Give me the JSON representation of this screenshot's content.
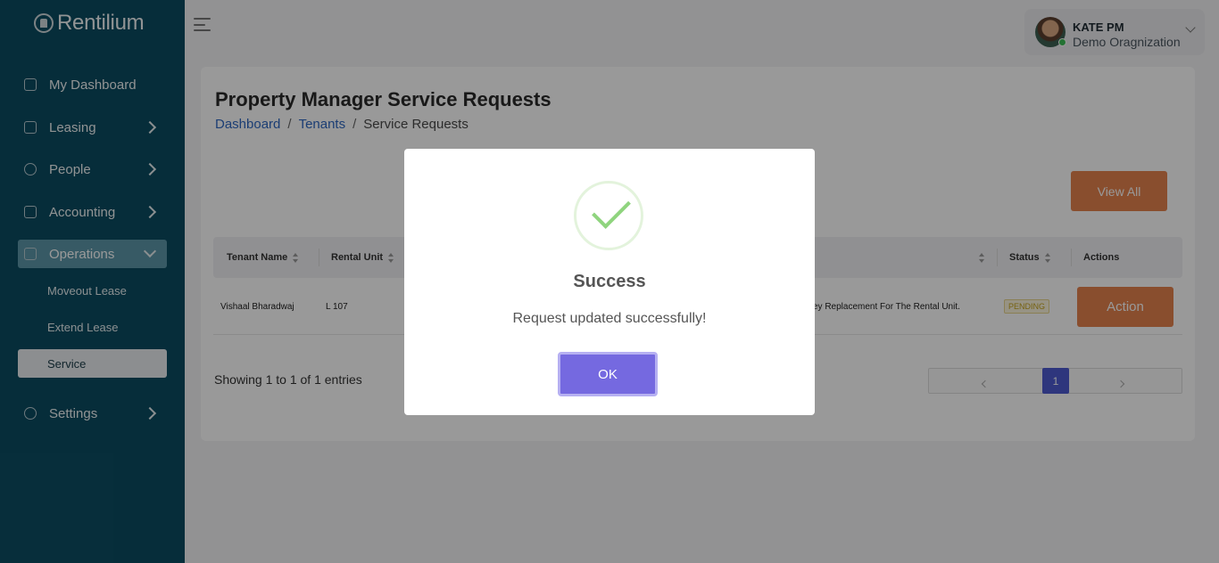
{
  "app": {
    "name": "Rentilium"
  },
  "sidebar": {
    "items": [
      {
        "label": "My Dashboard"
      },
      {
        "label": "Leasing"
      },
      {
        "label": "People"
      },
      {
        "label": "Accounting"
      },
      {
        "label": "Operations"
      },
      {
        "label": "Settings"
      }
    ],
    "subitems": [
      {
        "label": "Moveout Lease"
      },
      {
        "label": "Extend Lease"
      },
      {
        "label": "Service"
      }
    ]
  },
  "user": {
    "name": "KATE PM",
    "org": "Demo Oragnization"
  },
  "page": {
    "title": "Property Manager Service Requests",
    "breadcrumb": [
      "Dashboard",
      "Tenants",
      "Service Requests"
    ],
    "view_all": "View All"
  },
  "table": {
    "headers": [
      "Tenant Name",
      "Rental Unit",
      "Status",
      "Actions"
    ],
    "rows": [
      {
        "tenant": "Vishaal Bharadwaj",
        "unit": "L 107",
        "description_fragment": "ey Replacement For The Rental Unit.",
        "status": "PENDING",
        "action": "Action"
      }
    ],
    "showing": "Showing 1 to 1 of 1 entries",
    "current_page": "1"
  },
  "modal": {
    "title": "Success",
    "message": "Request updated successfully!",
    "ok": "OK"
  },
  "colors": {
    "sidebar": "#0b4c62",
    "accent_orange": "#e4824e",
    "ok_button": "#7569e0",
    "pager_active": "#4d5bd1",
    "success_check": "#8fd47e"
  }
}
